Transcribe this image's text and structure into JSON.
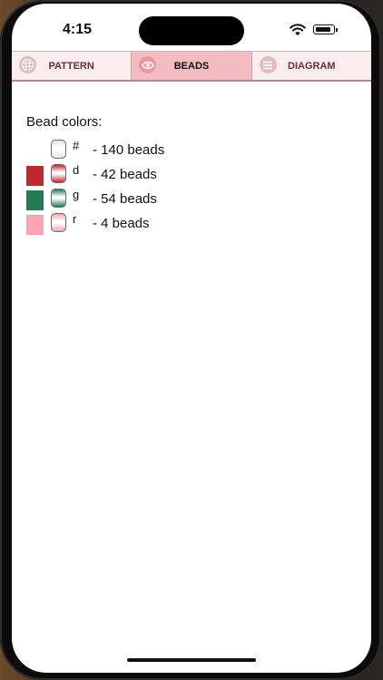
{
  "status_bar": {
    "time": "4:15",
    "battery_level": 0.92
  },
  "tabs": [
    {
      "label": "PATTERN",
      "icon": "grid-icon",
      "active": false
    },
    {
      "label": "BEADS",
      "icon": "eye-icon",
      "active": true
    },
    {
      "label": "DIAGRAM",
      "icon": "list-icon",
      "active": false
    }
  ],
  "heading": "Bead colors:",
  "beads": [
    {
      "swatch_color": null,
      "bead_color": "#e9e9e9",
      "symbol": "#",
      "count_text": "- 140 beads"
    },
    {
      "swatch_color": "#c0282f",
      "bead_color": "#c0282f",
      "symbol": "d",
      "count_text": "- 42 beads"
    },
    {
      "swatch_color": "#237a57",
      "bead_color": "#237a57",
      "symbol": "g",
      "count_text": "- 54 beads"
    },
    {
      "swatch_color": "#f9a6b0",
      "bead_color": "#f9a6b0",
      "symbol": "r",
      "count_text": "- 4 beads"
    }
  ],
  "colors": {
    "tab_bar_bg": "#fbeeee",
    "tab_active_bg": "#f3bcc0",
    "tab_text": "#6b2d35"
  }
}
